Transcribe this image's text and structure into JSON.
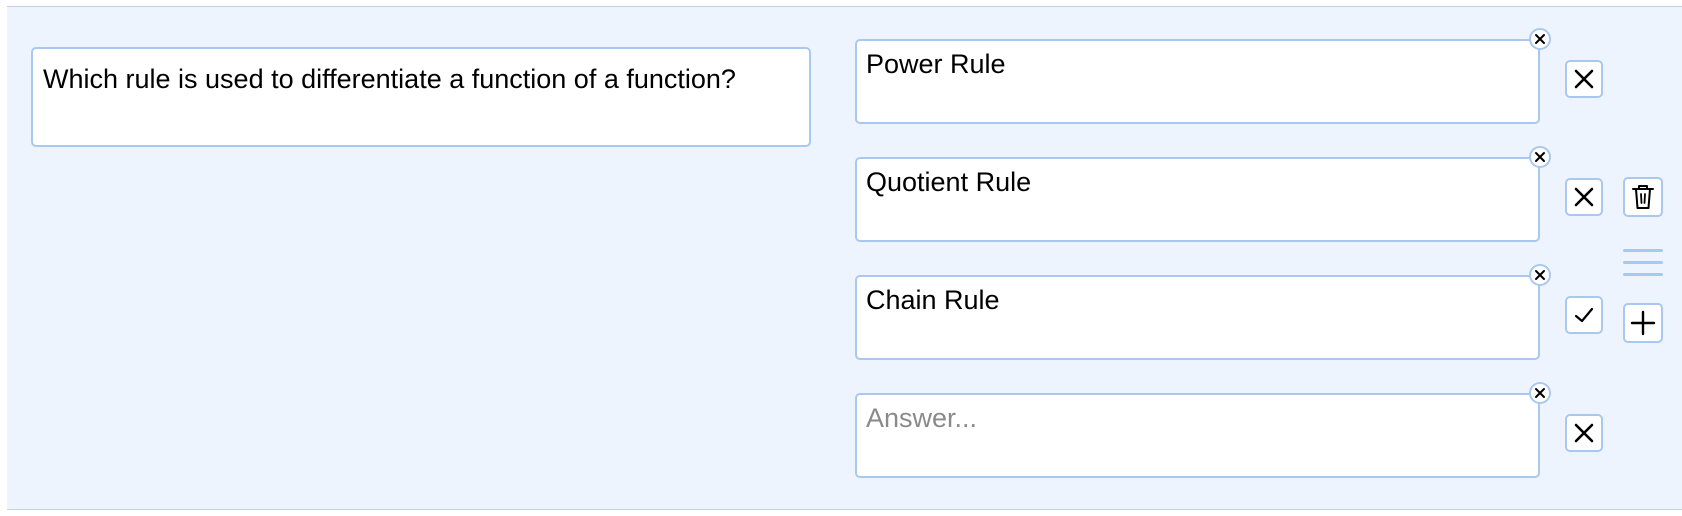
{
  "question": {
    "text": "Which rule is used to differentiate a function of a function?"
  },
  "answers": [
    {
      "text": "Power Rule",
      "placeholder": "",
      "correct": false,
      "mark_icon": "x-icon"
    },
    {
      "text": "Quotient Rule",
      "placeholder": "",
      "correct": false,
      "mark_icon": "x-icon"
    },
    {
      "text": "Chain Rule",
      "placeholder": "",
      "correct": true,
      "mark_icon": "check-icon"
    },
    {
      "text": "",
      "placeholder": "Answer...",
      "correct": false,
      "mark_icon": "x-icon"
    }
  ],
  "actions": {
    "delete_icon": "trash-icon",
    "drag_icon": "drag-handle-icon",
    "add_icon": "plus-icon"
  },
  "colors": {
    "panel_bg": "#eef4fd",
    "border": "#a9c8f0",
    "placeholder": "#8a8a8a"
  }
}
